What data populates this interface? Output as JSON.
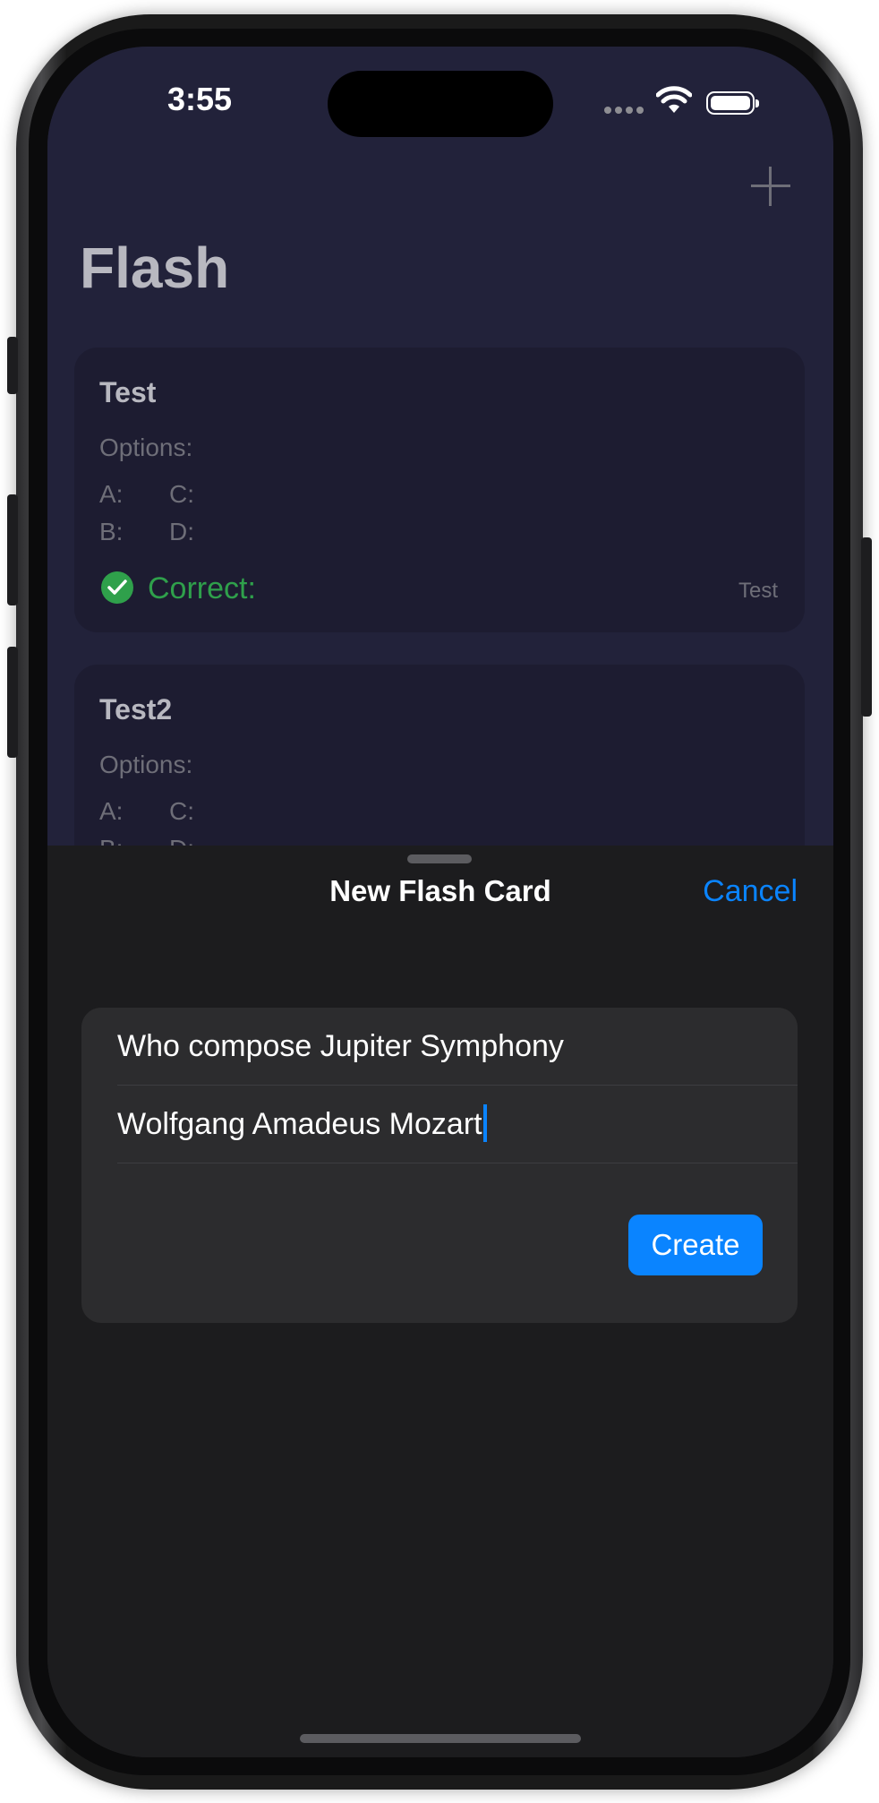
{
  "status_bar": {
    "time": "3:55",
    "icons": [
      "cellular-icon",
      "wifi-icon",
      "battery-icon"
    ]
  },
  "nav": {
    "add_icon": "plus-icon"
  },
  "app": {
    "title": "Flash"
  },
  "cards": [
    {
      "title": "Test",
      "options_label": "Options:",
      "option_a": "A:",
      "option_b": "B:",
      "option_c": "C:",
      "option_d": "D:",
      "correct_label": "Correct:",
      "answer": "Test"
    },
    {
      "title": "Test2",
      "options_label": "Options:",
      "option_a": "A:",
      "option_b": "B:",
      "option_c": "C:",
      "option_d": "D:"
    }
  ],
  "sheet": {
    "title": "New Flash Card",
    "cancel_label": "Cancel",
    "question_value": "Who compose Jupiter Symphony",
    "answer_value": "Wolfgang Amadeus Mozart",
    "create_label": "Create"
  },
  "colors": {
    "accent": "#0a84ff",
    "correct": "#2fa04b",
    "sheet_bg": "#1c1c1e",
    "group_bg": "#2c2c2e",
    "app_bg": "#22223a"
  }
}
